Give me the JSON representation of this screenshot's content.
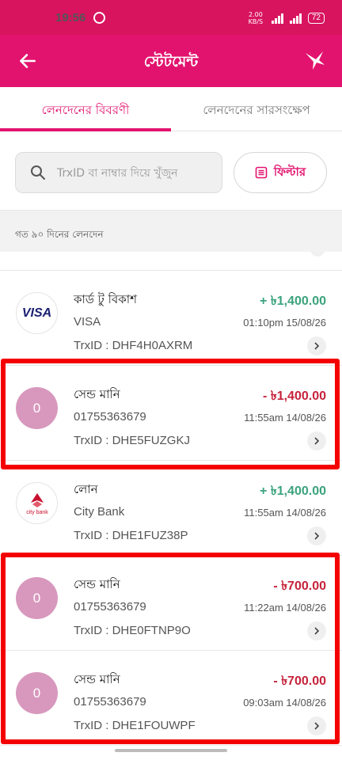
{
  "status_bar": {
    "time": "19:56",
    "network_speed": "2.00 KB/S",
    "battery": "72"
  },
  "app_bar": {
    "title": "স্টেটমেন্ট"
  },
  "tabs": [
    {
      "label": "লেনদেনের বিবরণী",
      "active": true
    },
    {
      "label": "লেনদেনের সারসংক্ষেপ",
      "active": false
    }
  ],
  "search": {
    "placeholder": "TrxID বা নাম্বার দিয়ে খুঁজুন",
    "value": ""
  },
  "filter": {
    "label": "ফিল্টার"
  },
  "period_label": "গত ৯০ দিনের লেনদেন",
  "transactions": [
    {
      "name": "কার্ড টু বিকাশ",
      "sub": "VISA",
      "trx": "TrxID : DHF4H0AXRM",
      "amount": "+ ৳1,400.00",
      "datetime": "01:10pm 15/08/26",
      "avatar_type": "logo",
      "avatar_text": "VISA"
    },
    {
      "name": "সেন্ড মানি",
      "sub": "01755363679",
      "trx": "TrxID : DHE5FUZGKJ",
      "amount": "- ৳1,400.00",
      "datetime": "11:55am 14/08/26",
      "avatar_type": "letter",
      "avatar_text": "0"
    },
    {
      "name": "লোন",
      "sub": "City Bank",
      "trx": "TrxID : DHE1FUZ38P",
      "amount": "+ ৳1,400.00",
      "datetime": "11:55am 14/08/26",
      "avatar_type": "logo",
      "avatar_text": "city bank"
    },
    {
      "name": "সেন্ড মানি",
      "sub": "01755363679",
      "trx": "TrxID : DHE0FTNP9O",
      "amount": "- ৳700.00",
      "datetime": "11:22am 14/08/26",
      "avatar_type": "letter",
      "avatar_text": "0"
    },
    {
      "name": "সেন্ড মানি",
      "sub": "01755363679",
      "trx": "TrxID : DHE1FOUWPF",
      "amount": "- ৳700.00",
      "datetime": "09:03am 14/08/26",
      "avatar_type": "letter",
      "avatar_text": "0"
    }
  ],
  "colors": {
    "brand": "#e2136e",
    "positive": "#3aa37d",
    "negative": "#c6233b",
    "highlight": "#f40000"
  }
}
